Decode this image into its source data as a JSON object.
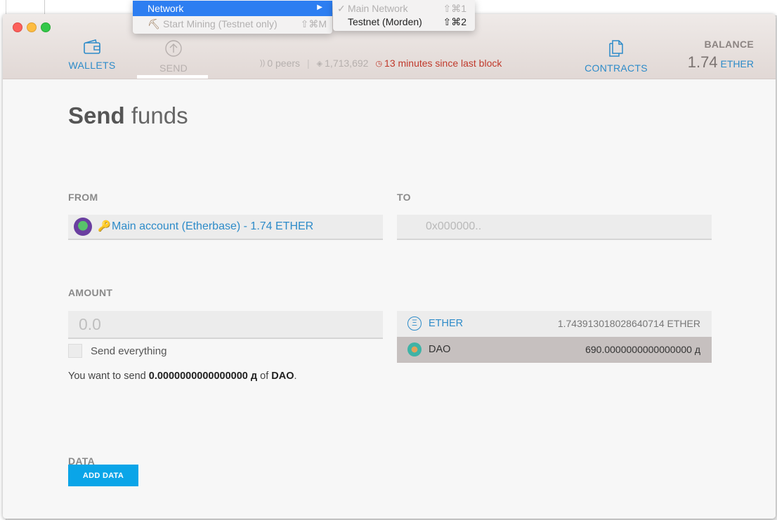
{
  "menubar": {
    "network_menu": {
      "items": [
        {
          "label": "Network",
          "arrow": "▶"
        },
        {
          "label": "Start Mining (Testnet only)",
          "shortcut": "⇧⌘M",
          "icon": "pickaxe-icon"
        }
      ]
    },
    "network_submenu": {
      "items": [
        {
          "label": "Main Network",
          "shortcut": "⇧⌘1",
          "check": "✓"
        },
        {
          "label": "Testnet (Morden)",
          "shortcut": "⇧⌘2"
        }
      ]
    }
  },
  "nav": {
    "wallets_label": "WALLETS",
    "send_label": "SEND",
    "contracts_label": "CONTRACTS"
  },
  "status": {
    "peers": "0 peers",
    "block": "1,713,692",
    "last_block": "13 minutes since last block"
  },
  "balance": {
    "title": "BALANCE",
    "value": "1.74",
    "unit": "ETHER"
  },
  "page": {
    "title_bold": "Send",
    "title_light": "funds"
  },
  "form": {
    "from_label": "FROM",
    "from_account": "Main account (Etherbase) - 1.74 ETHER",
    "to_label": "TO",
    "to_placeholder": "0x000000..",
    "amount_label": "AMOUNT",
    "amount_placeholder": "0.0",
    "send_everything": "Send everything",
    "summary_prefix": "You want to send ",
    "summary_amount": "0.0000000000000000 д",
    "summary_of": " of ",
    "summary_token": "DAO",
    "summary_suffix": ".",
    "data_label": "DATA",
    "add_data": "ADD DATA"
  },
  "tokens": [
    {
      "name": "ETHER",
      "balance": "1.743913018028640714 ETHER",
      "icon": "ether-icon"
    },
    {
      "name": "DAO",
      "balance": "690.0000000000000000 д",
      "icon": "dao-icon"
    }
  ],
  "colors": {
    "accent": "#2d8bc9",
    "button": "#0aa5e8",
    "warning": "#c0392b"
  }
}
